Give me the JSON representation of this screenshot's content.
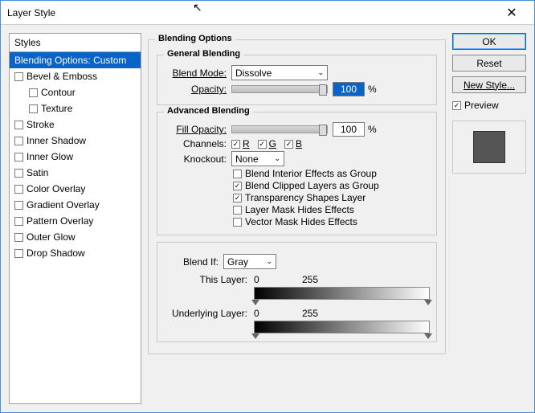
{
  "window": {
    "title": "Layer Style"
  },
  "styles": {
    "header": "Styles",
    "selected": "Blending Options: Custom",
    "items": [
      {
        "label": "Bevel & Emboss",
        "indent": false
      },
      {
        "label": "Contour",
        "indent": true
      },
      {
        "label": "Texture",
        "indent": true
      },
      {
        "label": "Stroke",
        "indent": false
      },
      {
        "label": "Inner Shadow",
        "indent": false
      },
      {
        "label": "Inner Glow",
        "indent": false
      },
      {
        "label": "Satin",
        "indent": false
      },
      {
        "label": "Color Overlay",
        "indent": false
      },
      {
        "label": "Gradient Overlay",
        "indent": false
      },
      {
        "label": "Pattern Overlay",
        "indent": false
      },
      {
        "label": "Outer Glow",
        "indent": false
      },
      {
        "label": "Drop Shadow",
        "indent": false
      }
    ]
  },
  "blending": {
    "title": "Blending Options",
    "general": {
      "title": "General Blending",
      "blend_mode_label": "Blend Mode:",
      "blend_mode_value": "Dissolve",
      "opacity_label": "Opacity:",
      "opacity_value": "100",
      "opacity_suffix": "%"
    },
    "advanced": {
      "title": "Advanced Blending",
      "fill_opacity_label": "Fill Opacity:",
      "fill_opacity_value": "100",
      "fill_opacity_suffix": "%",
      "channels_label": "Channels:",
      "ch_r": "R",
      "ch_g": "G",
      "ch_b": "B",
      "knockout_label": "Knockout:",
      "knockout_value": "None",
      "opt1": "Blend Interior Effects as Group",
      "opt2": "Blend Clipped Layers as Group",
      "opt3": "Transparency Shapes Layer",
      "opt4": "Layer Mask Hides Effects",
      "opt5": "Vector Mask Hides Effects"
    },
    "blendif": {
      "label": "Blend If:",
      "value": "Gray",
      "this_label": "This Layer:",
      "this_lo": "0",
      "this_hi": "255",
      "under_label": "Underlying Layer:",
      "under_lo": "0",
      "under_hi": "255"
    }
  },
  "buttons": {
    "ok": "OK",
    "reset": "Reset",
    "new_style": "New Style...",
    "preview": "Preview"
  }
}
